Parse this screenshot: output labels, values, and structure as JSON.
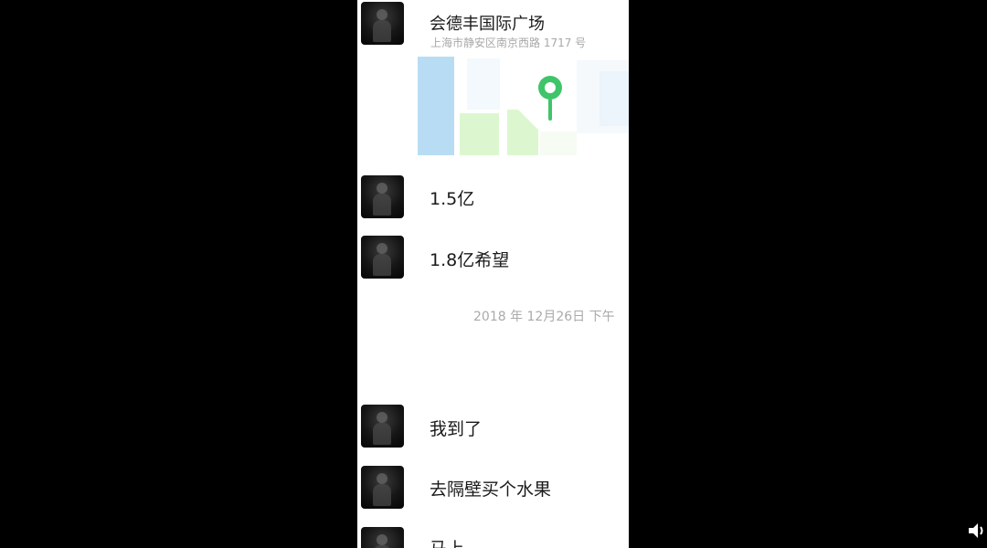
{
  "chat": {
    "location": {
      "title": "会德丰国际广场",
      "address": "上海市静安区南京西路 1717 号"
    },
    "messages": [
      {
        "text": "1.5亿"
      },
      {
        "text": "1.8亿希望"
      },
      {
        "text": "我到了"
      },
      {
        "text": "去隔壁买个水果"
      },
      {
        "text": "马上"
      }
    ],
    "timestamp": "2018 年 12月26日  下午"
  },
  "colors": {
    "map_blue": "#b9dcf5",
    "map_green": "#dcf7d0",
    "pin_green": "#3fc46a"
  },
  "icons": {
    "location_pin": "map-pin-icon",
    "speaker": "speaker-icon"
  }
}
